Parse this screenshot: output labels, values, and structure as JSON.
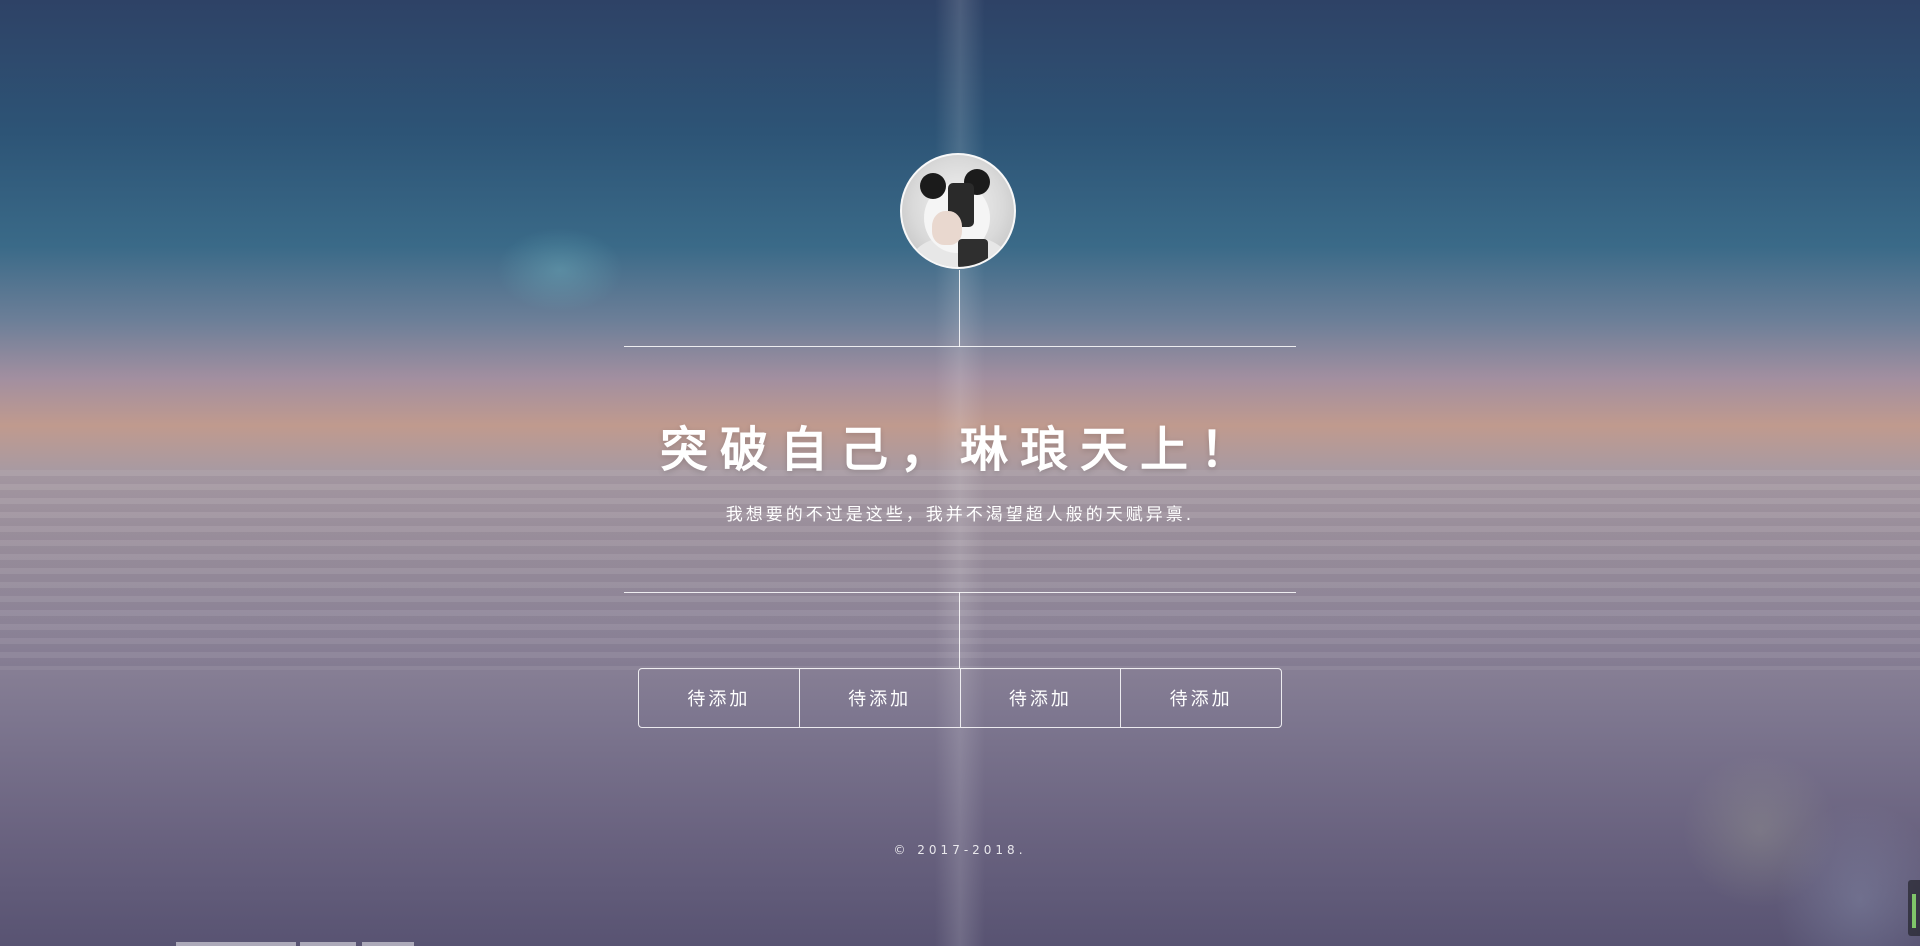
{
  "page": {
    "title": "突破自己，琳琅天上！",
    "subtitle": "我想要的不过是这些，我并不渴望超人般的天赋异禀.",
    "footer": "© 2017-2018."
  },
  "avatar": {
    "alt_icon": "profile-photo-panda-hood"
  },
  "nav": {
    "buttons": [
      {
        "label": "待添加"
      },
      {
        "label": "待添加"
      },
      {
        "label": "待添加"
      },
      {
        "label": "待添加"
      }
    ]
  },
  "colors": {
    "text": "#ffffff",
    "line": "#ffffff",
    "sky_top": "#2e4266",
    "clouds": "#9a8f9c"
  }
}
